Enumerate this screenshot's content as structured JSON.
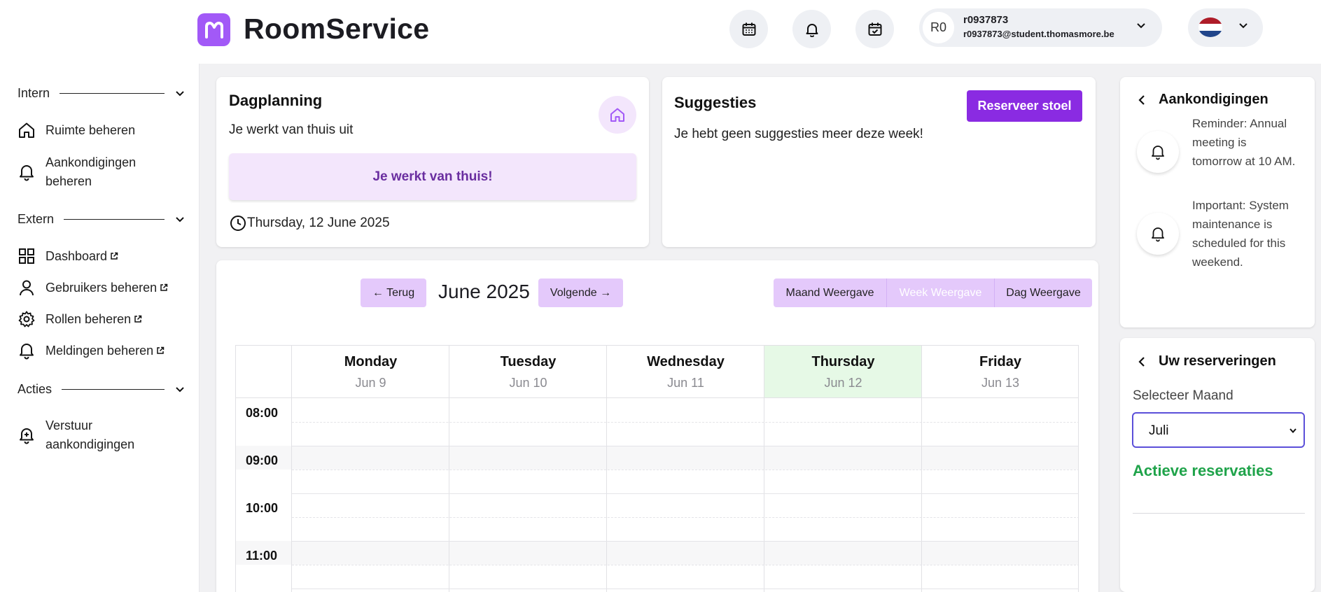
{
  "header": {
    "brand": "RoomService",
    "user": {
      "initials": "R0",
      "name": "r0937873",
      "email": "r0937873@student.thomasmore.be"
    }
  },
  "sidebar": {
    "sections": [
      {
        "label": "Intern"
      },
      {
        "label": "Extern"
      },
      {
        "label": "Acties"
      }
    ],
    "items": [
      {
        "label": "Ruimte beheren"
      },
      {
        "label": "Aankondigingen beheren"
      },
      {
        "label": "Dashboard"
      },
      {
        "label": "Gebruikers beheren"
      },
      {
        "label": "Rollen beheren"
      },
      {
        "label": "Meldingen beheren"
      },
      {
        "label": "Verstuur aankondigingen"
      }
    ]
  },
  "dagplanning": {
    "title": "Dagplanning",
    "subtitle": "Je werkt van thuis uit",
    "status": "Je werkt van thuis!",
    "date": "Thursday, 12 June 2025"
  },
  "suggesties": {
    "title": "Suggesties",
    "button": "Reserveer stoel",
    "message": "Je hebt geen suggesties meer deze week!"
  },
  "calendar": {
    "prev": "← Terug",
    "next": "Volgende →",
    "month": "June 2025",
    "views": [
      "Maand Weergave",
      "Week Weergave",
      "Dag Weergave"
    ],
    "active_view": "Week Weergave",
    "days": [
      {
        "name": "Monday",
        "date": "Jun 9"
      },
      {
        "name": "Tuesday",
        "date": "Jun 10"
      },
      {
        "name": "Wednesday",
        "date": "Jun 11"
      },
      {
        "name": "Thursday",
        "date": "Jun 12"
      },
      {
        "name": "Friday",
        "date": "Jun 13"
      }
    ],
    "today": "Thursday",
    "hours": [
      "08:00",
      "09:00",
      "10:00",
      "11:00"
    ]
  },
  "announcements": {
    "title": "Aankondigingen",
    "items": [
      {
        "text": "Reminder: Annual meeting is tomorrow at 10 AM."
      },
      {
        "text": "Important: System maintenance is scheduled for this weekend."
      }
    ]
  },
  "reservations": {
    "title": "Uw reserveringen",
    "select_label": "Selecteer Maand",
    "selected_month": "Juli",
    "active_title": "Actieve reservaties"
  },
  "colors": {
    "accent": "#8a2be2",
    "accent_light": "#f3e6fc",
    "today_bg": "#e6f9e6",
    "success": "#1fa34a"
  }
}
